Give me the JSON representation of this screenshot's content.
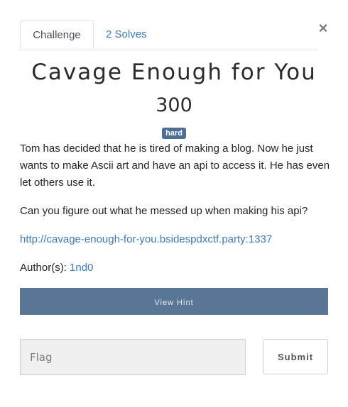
{
  "modal": {
    "close_glyph": "×",
    "tabs": {
      "challenge": "Challenge",
      "solves": "2 Solves"
    },
    "title": "Cavage Enough for You",
    "points": "300",
    "difficulty": "hard",
    "description": [
      "Tom has decided that he is tired of making a blog. Now he just wants to make Ascii art and have an api to access it. He has even let others use it.",
      "Can you figure out what he messed up when making his api?"
    ],
    "link": "http://cavage-enough-for-you.bsidespdxctf.party:1337",
    "author_label": "Author(s):",
    "author_name": "1nd0",
    "hint_button": "View Hint",
    "flag_placeholder": "Flag",
    "flag_value": "",
    "submit_button": "Submit"
  },
  "colors": {
    "link": "#3b7bbd",
    "badge": "#4e6e96",
    "hint_button_bg": "#5a7696"
  }
}
